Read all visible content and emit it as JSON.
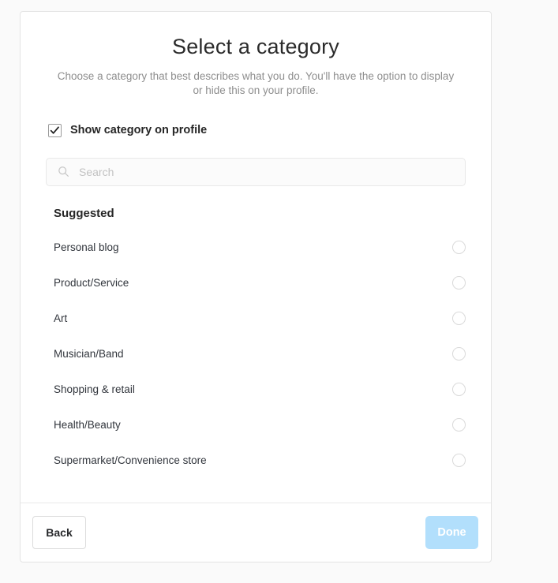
{
  "header": {
    "title": "Select a category",
    "subtitle": "Choose a category that best describes what you do. You'll have the option to display or hide this on your profile."
  },
  "show_on_profile": {
    "label": "Show category on profile",
    "checked": true,
    "icon": "check-icon"
  },
  "search": {
    "placeholder": "Search",
    "value": "",
    "icon": "search-icon"
  },
  "list": {
    "section_title": "Suggested",
    "items": [
      {
        "label": "Personal blog",
        "selected": false
      },
      {
        "label": "Product/Service",
        "selected": false
      },
      {
        "label": "Art",
        "selected": false
      },
      {
        "label": "Musician/Band",
        "selected": false
      },
      {
        "label": "Shopping & retail",
        "selected": false
      },
      {
        "label": "Health/Beauty",
        "selected": false
      },
      {
        "label": "Supermarket/Convenience store",
        "selected": false
      }
    ]
  },
  "footer": {
    "back_label": "Back",
    "done_label": "Done",
    "done_enabled": false
  },
  "colors": {
    "page_background": "#fafafa",
    "card_background": "#ffffff",
    "card_border": "#e4e4e4",
    "title_text": "#2b2b2b",
    "subtitle_text": "#8e8e8e",
    "item_text": "#31353c",
    "radio_border": "#dadada",
    "done_button_disabled": "#b2dffc",
    "done_button_text": "#ffffff",
    "search_background": "#fbfbfb",
    "placeholder_text": "#c2c2c2"
  }
}
